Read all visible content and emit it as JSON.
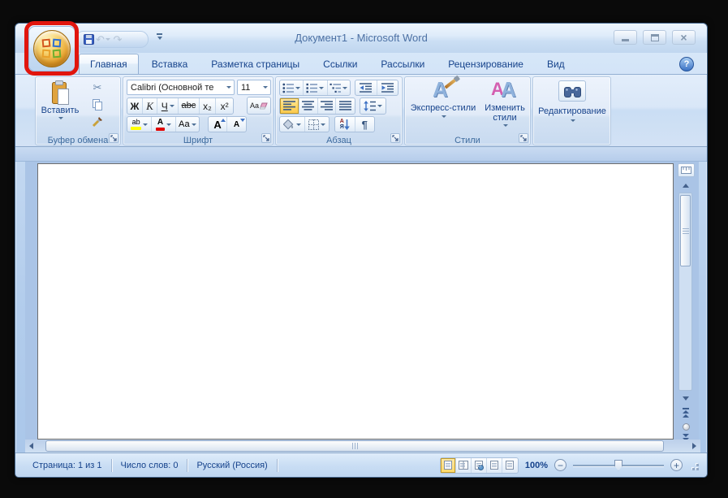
{
  "window": {
    "title": "Документ1 - Microsoft Word",
    "close_glyph": "×",
    "help_glyph": "?"
  },
  "qat": {
    "undo_glyph": "↶",
    "redo_glyph": "↷"
  },
  "tabs": [
    {
      "label": "Главная",
      "active": true
    },
    {
      "label": "Вставка",
      "active": false
    },
    {
      "label": "Разметка страницы",
      "active": false
    },
    {
      "label": "Ссылки",
      "active": false
    },
    {
      "label": "Рассылки",
      "active": false
    },
    {
      "label": "Рецензирование",
      "active": false
    },
    {
      "label": "Вид",
      "active": false
    }
  ],
  "ribbon": {
    "clipboard": {
      "group_label": "Буфер обмена",
      "paste_label": "Вставить",
      "cut_glyph": "✂"
    },
    "font": {
      "group_label": "Шрифт",
      "font_name": "Calibri (Основной те",
      "font_size": "11",
      "bold_glyph": "Ж",
      "italic_glyph": "К",
      "underline_glyph": "Ч",
      "strikethrough_glyph": "abc",
      "subscript_glyph": "x₂",
      "superscript_glyph": "x²",
      "clear_format_glyph": "Аа",
      "highlight_glyph": "ab",
      "font_color_glyph": "А",
      "change_case_glyph": "Аа",
      "grow_font_glyph": "А",
      "shrink_font_glyph": "А"
    },
    "paragraph": {
      "group_label": "Абзац",
      "sort_top_glyph": "А",
      "sort_bottom_glyph": "Я",
      "pilcrow_glyph": "¶"
    },
    "styles": {
      "group_label": "Стили",
      "quick_styles_label": "Экспресс-стили",
      "change_styles_label": "Изменить стили",
      "quick_styles_icon_glyph": "A",
      "change_styles_icon_glyph_1": "A",
      "change_styles_icon_glyph_2": "A"
    },
    "editing": {
      "label": "Редактирование"
    }
  },
  "statusbar": {
    "page_info": "Страница: 1 из 1",
    "word_count": "Число слов: 0",
    "language": "Русский (Россия)",
    "zoom_level": "100%",
    "zoom_out_glyph": "−",
    "zoom_in_glyph": "+"
  },
  "colors": {
    "annotation_red": "#e1150d",
    "highlight_yellow": "#ffff00",
    "font_color_red": "#e00000",
    "active_selection_orange": "#ffd968"
  },
  "annotation": {
    "highlighted_element": "office-button"
  }
}
